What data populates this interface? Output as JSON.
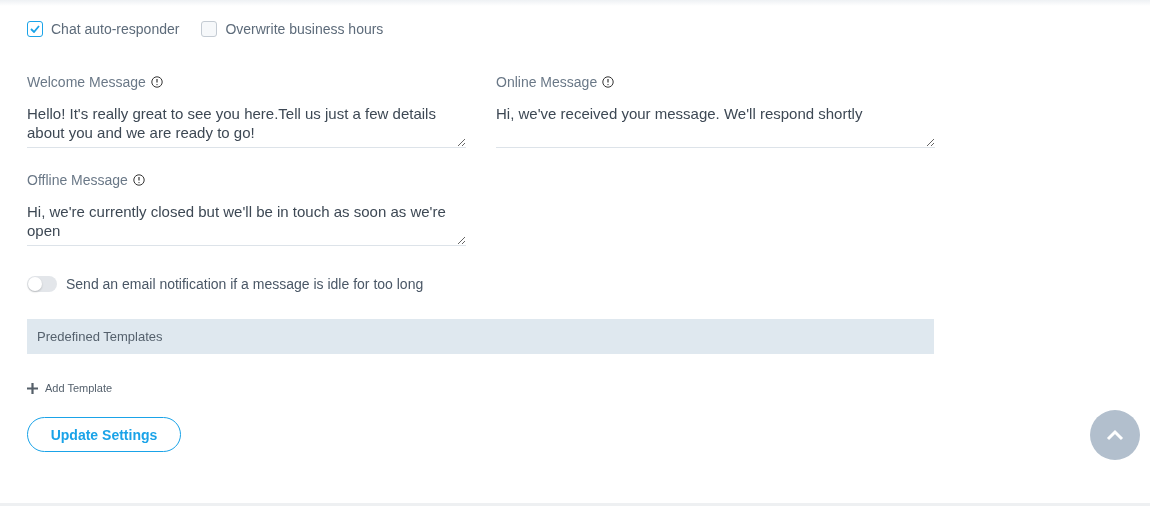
{
  "checkboxes": [
    {
      "label": "Chat auto-responder",
      "checked": true
    },
    {
      "label": "Overwrite business hours",
      "checked": false
    }
  ],
  "messages": [
    {
      "label": "Welcome Message",
      "value": "Hello! It's really great to see you here.Tell us just a few details about you and we are ready to go!"
    },
    {
      "label": "Online Message",
      "value": "Hi, we've received your message. We'll respond shortly"
    },
    {
      "label": "Offline Message",
      "value": "Hi, we're currently closed but we'll be in touch as soon as we're open"
    }
  ],
  "notification_toggle": {
    "label": "Send an email notification if a message is idle for too long",
    "on": false
  },
  "templates": {
    "title": "Predefined Templates",
    "add_label": "Add Template"
  },
  "submit_button": "Update Settings"
}
